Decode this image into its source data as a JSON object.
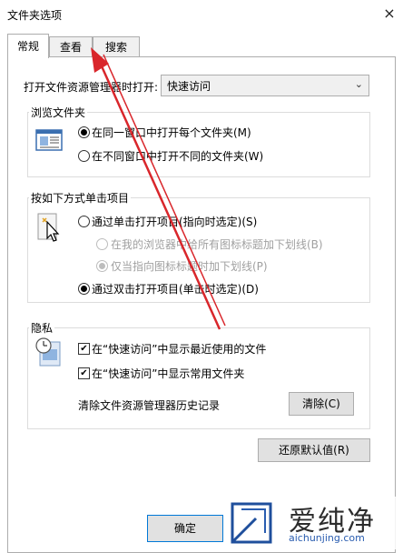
{
  "window": {
    "title": "文件夹选项",
    "close_glyph": "×"
  },
  "tabs": [
    {
      "label": "常规",
      "active": true
    },
    {
      "label": "查看",
      "active": false
    },
    {
      "label": "搜索",
      "active": false
    }
  ],
  "open_explorer": {
    "label": "打开文件资源管理器时打开:",
    "value": "快速访问"
  },
  "browse_folders": {
    "legend": "浏览文件夹",
    "option_same": "在同一窗口中打开每个文件夹(M)",
    "option_new": "在不同窗口中打开不同的文件夹(W)",
    "icon": "folder-window-icon"
  },
  "click_items": {
    "legend": "按如下方式单击项目",
    "option_single": "通过单击打开项目(指向时选定)(S)",
    "sub_browser": "在我的浏览器中给所有图标标题加下划线(B)",
    "sub_point": "仅当指向图标标题时加下划线(P)",
    "option_double": "通过双击打开项目(单击时选定)(D)",
    "icon": "cursor-click-icon"
  },
  "privacy": {
    "legend": "隐私",
    "show_recent": "在“快速访问”中显示最近使用的文件",
    "show_frequent": "在“快速访问”中显示常用文件夹",
    "clear_label": "清除文件资源管理器历史记录",
    "clear_button": "清除(C)",
    "icon": "privacy-clock-icon"
  },
  "restore_button": "还原默认值(R)",
  "ok_button": "确定",
  "watermark": {
    "name": "爱纯净",
    "url": "aichunjing.com",
    "icon": "logo-icon"
  },
  "colors": {
    "arrow": "#d9262b",
    "accent": "#2a5db0"
  }
}
